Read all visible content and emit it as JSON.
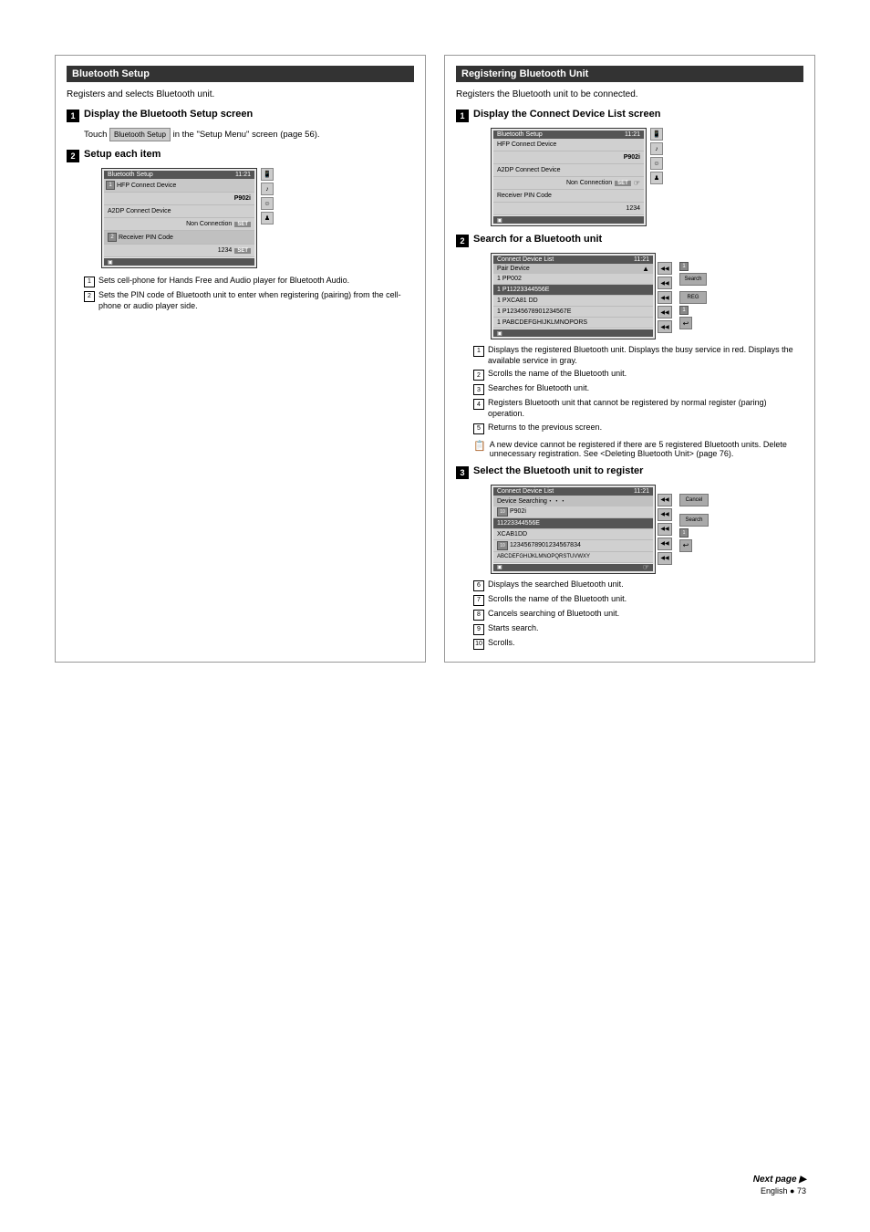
{
  "page": {
    "language": "English",
    "page_number": "73",
    "next_page_label": "Next page ▶"
  },
  "left_section": {
    "title": "Bluetooth Setup",
    "intro": "Registers and selects Bluetooth unit.",
    "step1": {
      "number": "1",
      "title": "Display the Bluetooth Setup screen",
      "content_prefix": "Touch",
      "button_label": "Bluetooth Setup",
      "content_suffix": "in the \"Setup Menu\" screen (page 56)."
    },
    "step2": {
      "number": "2",
      "title": "Setup each item",
      "screen": {
        "title": "Bluetooth Setup",
        "time": "11:21",
        "rows": [
          {
            "label": "HFP Connect Device",
            "value": "",
            "type": "header-row"
          },
          {
            "label": "",
            "value": "P902i",
            "type": "value-row"
          },
          {
            "label": "A2DP Connect Device",
            "value": "",
            "type": "header-row"
          },
          {
            "label": "",
            "value": "Non Connection",
            "button": "SET",
            "type": "button-row"
          },
          {
            "label": "Receiver PIN Code",
            "value": "",
            "type": "header-row"
          },
          {
            "label": "",
            "value": "1234",
            "button": "SET",
            "type": "button-row"
          }
        ]
      }
    },
    "annotations": [
      {
        "num": "1",
        "text": "Sets cell-phone for Hands Free and Audio player for Bluetooth Audio."
      },
      {
        "num": "2",
        "text": "Sets the PIN code of Bluetooth unit to enter when registering (pairing) from the cell-phone or audio player side."
      }
    ]
  },
  "right_section": {
    "title": "Registering Bluetooth Unit",
    "intro": "Registers the Bluetooth unit to be connected.",
    "step1": {
      "number": "1",
      "title": "Display the Connect Device List screen",
      "screen": {
        "title": "Bluetooth Setup",
        "time": "11:21",
        "rows": [
          {
            "label": "HFP Connect Device",
            "type": "header"
          },
          {
            "label": "P902i",
            "type": "value"
          },
          {
            "label": "A2DP Connect Device",
            "type": "header"
          },
          {
            "label": "Non Connection",
            "button": "SET",
            "type": "button-row"
          },
          {
            "label": "Receiver PIN Code",
            "type": "header"
          },
          {
            "label": "1234",
            "type": "value"
          }
        ]
      }
    },
    "step2": {
      "number": "2",
      "title": "Search for a Bluetooth unit",
      "screen": {
        "title": "Connect Device List",
        "subtitle": "Pair Device",
        "time": "11:21",
        "rows": [
          {
            "text": "1 PP002",
            "selected": false
          },
          {
            "text": "1 P11223344556E",
            "selected": false
          },
          {
            "text": "1 PXCA81 DD",
            "selected": false
          },
          {
            "text": "1 P12345678901234567E",
            "selected": false
          },
          {
            "text": "1 PABCDEFGHIJKLMNOPORS",
            "selected": false
          }
        ],
        "action_buttons": [
          "Search",
          "REG"
        ]
      },
      "annotations": [
        {
          "num": "1",
          "text": "Displays the registered Bluetooth unit. Displays the busy service in red. Displays the available service in gray."
        },
        {
          "num": "2",
          "text": "Scrolls the name of the Bluetooth unit."
        },
        {
          "num": "3",
          "text": "Searches for Bluetooth unit."
        },
        {
          "num": "4",
          "text": "Registers Bluetooth unit that cannot be registered by normal register (paring) operation."
        },
        {
          "num": "5",
          "text": "Returns to the previous screen."
        }
      ]
    },
    "note": {
      "icon": "📋",
      "text": "A new device cannot be registered if there are 5 registered Bluetooth units. Delete unnecessary registration. See <Deleting Bluetooth Unit> (page 76)."
    },
    "step3": {
      "number": "3",
      "title": "Select the Bluetooth unit to register",
      "screen": {
        "title": "Connect Device List",
        "subtitle": "Device Searching・・・",
        "time": "11:21",
        "rows": [
          {
            "num": "10",
            "text": "P902i",
            "selected": true
          },
          {
            "text": "11223344556E",
            "selected": false
          },
          {
            "text": "XCAB1DD",
            "selected": false
          },
          {
            "num": "10",
            "text": "12345678901234567834",
            "selected": false
          },
          {
            "text": "ABCDEFGHIJKLMNOPQRSTUVWXY",
            "selected": false
          }
        ],
        "action_buttons": [
          "Cancel",
          "Search"
        ]
      },
      "annotations": [
        {
          "num": "6",
          "text": "Displays the searched Bluetooth unit."
        },
        {
          "num": "7",
          "text": "Scrolls the name of the Bluetooth unit."
        },
        {
          "num": "8",
          "text": "Cancels searching of Bluetooth unit."
        },
        {
          "num": "9",
          "text": "Starts search."
        },
        {
          "num": "10",
          "text": "Scrolls."
        }
      ]
    }
  }
}
